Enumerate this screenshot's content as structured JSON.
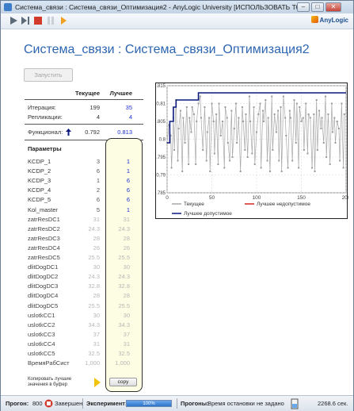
{
  "window": {
    "title": "Система_связи : Система_связи_Оптимизация2 - AnyLogic University  [ИСПОЛЬЗОВАТЬ ТОЛЬКО В ОБРАЗОВ...",
    "minimize": "–",
    "maximize": "□",
    "close": "✕"
  },
  "toolbar": {
    "logo_text": "AnyLogic",
    "icons": [
      "run-icon",
      "step-icon",
      "stop-icon",
      "pause-icon",
      "debug-icon"
    ]
  },
  "page_title": "Система_связи : Система_связи_Оптимизация2",
  "run_button": "Запустить",
  "stats": {
    "header_current": "Текущее",
    "header_best": "Лучшее",
    "rows": [
      {
        "label": "Итерация:",
        "current": "199",
        "best": "35"
      },
      {
        "label": "Репликации:",
        "current": "4",
        "best": "4"
      }
    ],
    "objective": {
      "label": "Функционал:",
      "current": "0.792",
      "best": "0.813"
    }
  },
  "params_title": "Параметры",
  "params": [
    {
      "name": "KCDP_1",
      "current": "3",
      "best": "1",
      "grey": false
    },
    {
      "name": "KCDP_2",
      "current": "6",
      "best": "1",
      "grey": false
    },
    {
      "name": "KCDP_3",
      "current": "1",
      "best": "6",
      "grey": false
    },
    {
      "name": "KCDP_4",
      "current": "2",
      "best": "6",
      "grey": false
    },
    {
      "name": "KCDP_5",
      "current": "6",
      "best": "6",
      "grey": false
    },
    {
      "name": "Kol_master",
      "current": "5",
      "best": "1",
      "grey": false
    },
    {
      "name": "zatrResDC1",
      "current": "31",
      "best": "31",
      "grey": true
    },
    {
      "name": "zatrResDC2",
      "current": "24.3",
      "best": "24.3",
      "grey": true
    },
    {
      "name": "zatrResDC3",
      "current": "28",
      "best": "28",
      "grey": true
    },
    {
      "name": "zatrResDC4",
      "current": "26",
      "best": "26",
      "grey": true
    },
    {
      "name": "zatrResDC5",
      "current": "25.5",
      "best": "25.5",
      "grey": true
    },
    {
      "name": "dlitDogDC1",
      "current": "30",
      "best": "30",
      "grey": true
    },
    {
      "name": "dlitDogDC2",
      "current": "24.3",
      "best": "24.3",
      "grey": true
    },
    {
      "name": "dlitDogDC3",
      "current": "32.8",
      "best": "32.8",
      "grey": true
    },
    {
      "name": "dlitDogDC4",
      "current": "28",
      "best": "28",
      "grey": true
    },
    {
      "name": "dlitDogDC5",
      "current": "25.5",
      "best": "25.5",
      "grey": true
    },
    {
      "name": "uslotkCC1",
      "current": "30",
      "best": "30",
      "grey": true
    },
    {
      "name": "uslotkCC2",
      "current": "34.3",
      "best": "34.3",
      "grey": true
    },
    {
      "name": "uslotkCC3",
      "current": "37",
      "best": "37",
      "grey": true
    },
    {
      "name": "uslotkCC4",
      "current": "31",
      "best": "31",
      "grey": true
    },
    {
      "name": "uslotkCC5",
      "current": "32.5",
      "best": "32.5",
      "grey": true
    },
    {
      "name": "ВремяРабСист",
      "current": "1,000",
      "best": "1,000",
      "grey": true
    }
  ],
  "copy": {
    "label_line1": "Копировать лучшие",
    "label_line2": "значения в буфер",
    "button": "copy"
  },
  "colors": {
    "title": "#2d65b0",
    "best_value": "#1b2fd1",
    "current_series": "#a8a8a8",
    "best_feasible_series": "#d6261e",
    "best_admissible_series": "#0c1a80",
    "optbox_fill": "#fdfde3"
  },
  "chart_data": {
    "type": "line",
    "xlim": [
      0,
      200
    ],
    "ylim": [
      0.785,
      0.815
    ],
    "x_ticks": [
      "0",
      "50",
      "100",
      "150",
      "200"
    ],
    "y_ticks": [
      "0.785",
      "0.79",
      "0.795",
      "0.8",
      "0.805",
      "0.81",
      "0.815"
    ],
    "grid": true,
    "legend": [
      "Текущее",
      "Лучшее недопустимое",
      "Лучшее допустимое"
    ],
    "series": [
      {
        "name": "Текущее",
        "x": [
          0,
          2,
          4,
          5,
          7,
          8,
          10,
          12,
          13,
          15,
          17,
          18,
          20,
          22,
          24,
          25,
          27,
          28,
          30,
          32,
          33,
          35,
          37,
          38,
          40,
          42,
          44,
          45,
          47,
          48,
          50,
          52,
          53,
          55,
          57,
          58,
          60,
          62,
          64,
          65,
          67,
          68,
          70,
          72,
          73,
          75,
          77,
          78,
          80,
          82,
          84,
          85,
          87,
          88,
          90,
          92,
          93,
          95,
          97,
          98,
          100,
          102,
          104,
          105,
          107,
          108,
          110,
          112,
          113,
          115,
          117,
          118,
          120,
          122,
          124,
          125,
          127,
          128,
          130,
          132,
          133,
          135,
          137,
          138,
          140,
          142,
          144,
          145,
          147,
          148,
          150,
          152,
          153,
          155,
          157,
          158,
          160,
          162,
          164,
          165,
          167,
          168,
          170,
          172,
          173,
          175,
          177,
          178,
          180,
          182,
          184,
          185,
          187,
          188,
          190,
          192,
          193,
          195,
          197,
          198
        ],
        "values": [
          0.799,
          0.804,
          0.801,
          0.792,
          0.806,
          0.797,
          0.811,
          0.794,
          0.803,
          0.808,
          0.791,
          0.806,
          0.799,
          0.809,
          0.793,
          0.806,
          0.802,
          0.809,
          0.807,
          0.793,
          0.805,
          0.81,
          0.812,
          0.806,
          0.797,
          0.809,
          0.794,
          0.802,
          0.806,
          0.791,
          0.81,
          0.805,
          0.796,
          0.807,
          0.793,
          0.81,
          0.801,
          0.805,
          0.792,
          0.809,
          0.806,
          0.799,
          0.794,
          0.808,
          0.795,
          0.803,
          0.81,
          0.799,
          0.806,
          0.791,
          0.809,
          0.805,
          0.797,
          0.807,
          0.795,
          0.812,
          0.805,
          0.796,
          0.809,
          0.793,
          0.802,
          0.807,
          0.81,
          0.792,
          0.808,
          0.805,
          0.811,
          0.794,
          0.806,
          0.791,
          0.812,
          0.797,
          0.807,
          0.802,
          0.808,
          0.794,
          0.809,
          0.791,
          0.812,
          0.806,
          0.801,
          0.792,
          0.808,
          0.806,
          0.794,
          0.811,
          0.799,
          0.81,
          0.792,
          0.809,
          0.805,
          0.806,
          0.797,
          0.81,
          0.796,
          0.807,
          0.806,
          0.792,
          0.807,
          0.791,
          0.811,
          0.797,
          0.808,
          0.803,
          0.806,
          0.799,
          0.812,
          0.795,
          0.807,
          0.793,
          0.81,
          0.802,
          0.806,
          0.799,
          0.805,
          0.803,
          0.794,
          0.81,
          0.792,
          0.807
        ]
      },
      {
        "name": "Лучшее допустимое",
        "x": [
          0,
          3,
          3,
          7,
          7,
          10,
          10,
          35,
          35,
          200
        ],
        "values": [
          0.799,
          0.799,
          0.805,
          0.805,
          0.809,
          0.809,
          0.811,
          0.811,
          0.813,
          0.813
        ]
      }
    ]
  },
  "status": {
    "run_label": "Прогон:",
    "run_value": "800",
    "finished": "Завершен",
    "experiment_label": "Эксперимент:",
    "progress_percent": "100%",
    "progress_value": 1.0,
    "runs_label": "Прогоны:",
    "stop_time": "Время остановки не задано",
    "memory": "2268.6 сек."
  }
}
